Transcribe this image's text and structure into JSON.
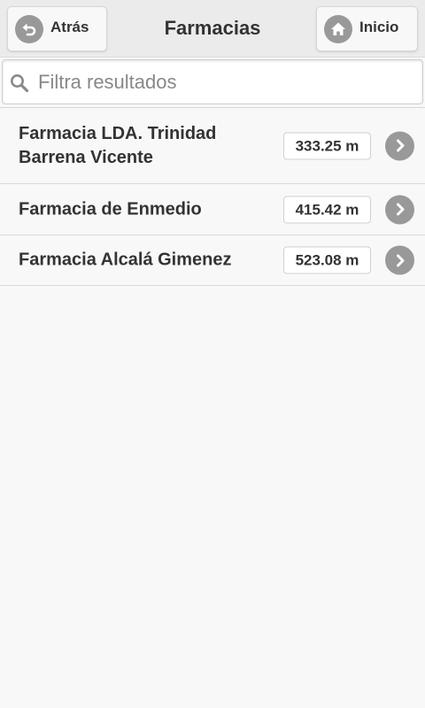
{
  "header": {
    "back_label": "Atrás",
    "title": "Farmacias",
    "home_label": "Inicio"
  },
  "search": {
    "placeholder": "Filtra resultados",
    "value": ""
  },
  "results": [
    {
      "name": "Farmacia LDA. Trinidad Barrena Vicente",
      "distance": "333.25 m"
    },
    {
      "name": "Farmacia de Enmedio",
      "distance": "415.42 m"
    },
    {
      "name": "Farmacia Alcalá Gimenez",
      "distance": "523.08 m"
    }
  ],
  "icons": {
    "back": "back-arrow-icon",
    "home": "home-icon",
    "search": "search-icon",
    "row": "chevron-right-icon"
  },
  "colors": {
    "header_bg": "#ebebeb",
    "page_bg": "#f8f8f8",
    "icon_bg": "#999999",
    "text": "#333333"
  }
}
